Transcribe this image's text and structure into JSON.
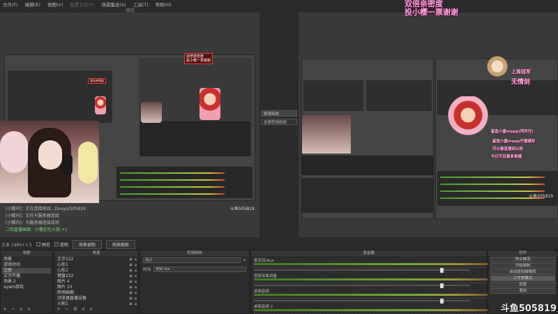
{
  "menu": [
    "文件(F)",
    "编辑(E)",
    "视图(V)",
    "配置文件(P)",
    "场景集合(S)",
    "工具(T)",
    "帮助(H)"
  ],
  "preview_label": "预览",
  "overlay": {
    "line1": "双倍亲密度",
    "line2": "投小樱一票谢谢"
  },
  "badge": {
    "line1": "双倍亲密度",
    "line2": "投小樱一票谢谢"
  },
  "inner_overlay": [
    "上周冠军",
    "无情剑",
    "鲨鱼小墨mapp(同时代)",
    "鲨鱼小墨mapp开播通知",
    "可以看直播间公告",
    "今日节目最多录播"
  ],
  "transition_mid": {
    "btn": "转场特效",
    "select": "全屏转场特效"
  },
  "log": [
    "[小樱内]：正在连接房间...Douyu/505819",
    "[小樱内]：正在与服务器连接",
    "[小樱内]：与服务器连接成功",
    "二哈直播画面：小樱在吃火锅 +1"
  ],
  "small_watermark": "斗鱼505819",
  "status": {
    "text": "文本 1980+1 5",
    "checks": [
      "预览",
      "透明"
    ],
    "btn1": "场景录制",
    "btn2": "场景截图"
  },
  "scenes": {
    "title": "场景",
    "items": [
      "场景",
      "游戏时间",
      "注册",
      "文字开播",
      "场景 2",
      "ayam游戏"
    ],
    "selected": 2
  },
  "sources": {
    "title": "来源",
    "items": [
      "文字222",
      "心形1",
      "心形2",
      "键盘222",
      "图片 4",
      "图片 10",
      "转场画面",
      "浏览器直播设备",
      "火影1"
    ]
  },
  "transitions": {
    "title": "转场特效",
    "value": "淡入",
    "duration_label": "时长",
    "duration": "300 ms"
  },
  "mixer": {
    "title": "混音器",
    "channels": [
      {
        "name": "麦克风/Aux",
        "db": "-inf dB",
        "level": 0.86
      },
      {
        "name": "视频采集设备",
        "db": "-inf dB",
        "level": 0.86
      },
      {
        "name": "桌面音频",
        "db": "-inf dB",
        "level": 0.86
      },
      {
        "name": "桌面音频 2",
        "db": "-inf dB",
        "level": 0.86
      }
    ]
  },
  "controls": {
    "title": "控件",
    "buttons": [
      "停止推流",
      "开始录制",
      "启动虚拟摄像机",
      "工作室模式",
      "设置",
      "退出"
    ],
    "active": 3
  },
  "watermark": "斗鱼505819"
}
